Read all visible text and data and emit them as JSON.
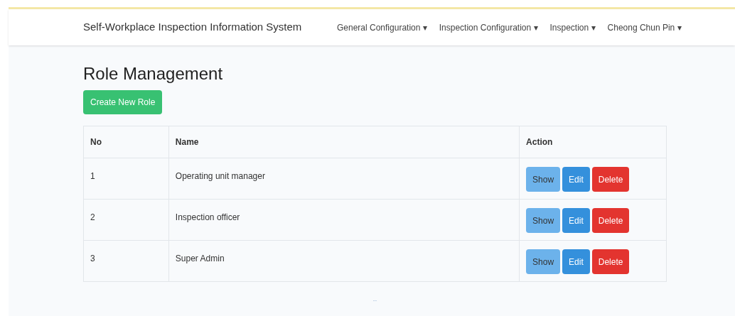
{
  "navbar": {
    "brand": "Self-Workplace Inspection Information System",
    "menus": [
      {
        "label": "General Configuration",
        "caret": "▾"
      },
      {
        "label": "Inspection Configuration",
        "caret": "▾"
      },
      {
        "label": "Inspection",
        "caret": "▾"
      },
      {
        "label": "Cheong Chun Pin",
        "caret": "▾"
      }
    ]
  },
  "page_title": "Role Management",
  "create_button": "Create New Role",
  "table": {
    "columns": [
      "No",
      "Name",
      "Action"
    ],
    "rows": [
      {
        "no": "1",
        "name": "Operating unit manager",
        "actions": [
          {
            "kind": "show",
            "label": "Show"
          },
          {
            "kind": "edit",
            "label": "Edit"
          },
          {
            "kind": "delete",
            "label": "Delete"
          }
        ]
      },
      {
        "no": "2",
        "name": "Inspection officer",
        "actions": [
          {
            "kind": "show",
            "label": "Show"
          },
          {
            "kind": "edit",
            "label": "Edit"
          },
          {
            "kind": "delete",
            "label": "Delete"
          }
        ]
      },
      {
        "no": "3",
        "name": "Super Admin",
        "actions": [
          {
            "kind": "show",
            "label": "Show"
          },
          {
            "kind": "edit",
            "label": "Edit"
          },
          {
            "kind": "delete",
            "label": "Delete"
          }
        ]
      }
    ]
  },
  "footer_mark": "--"
}
